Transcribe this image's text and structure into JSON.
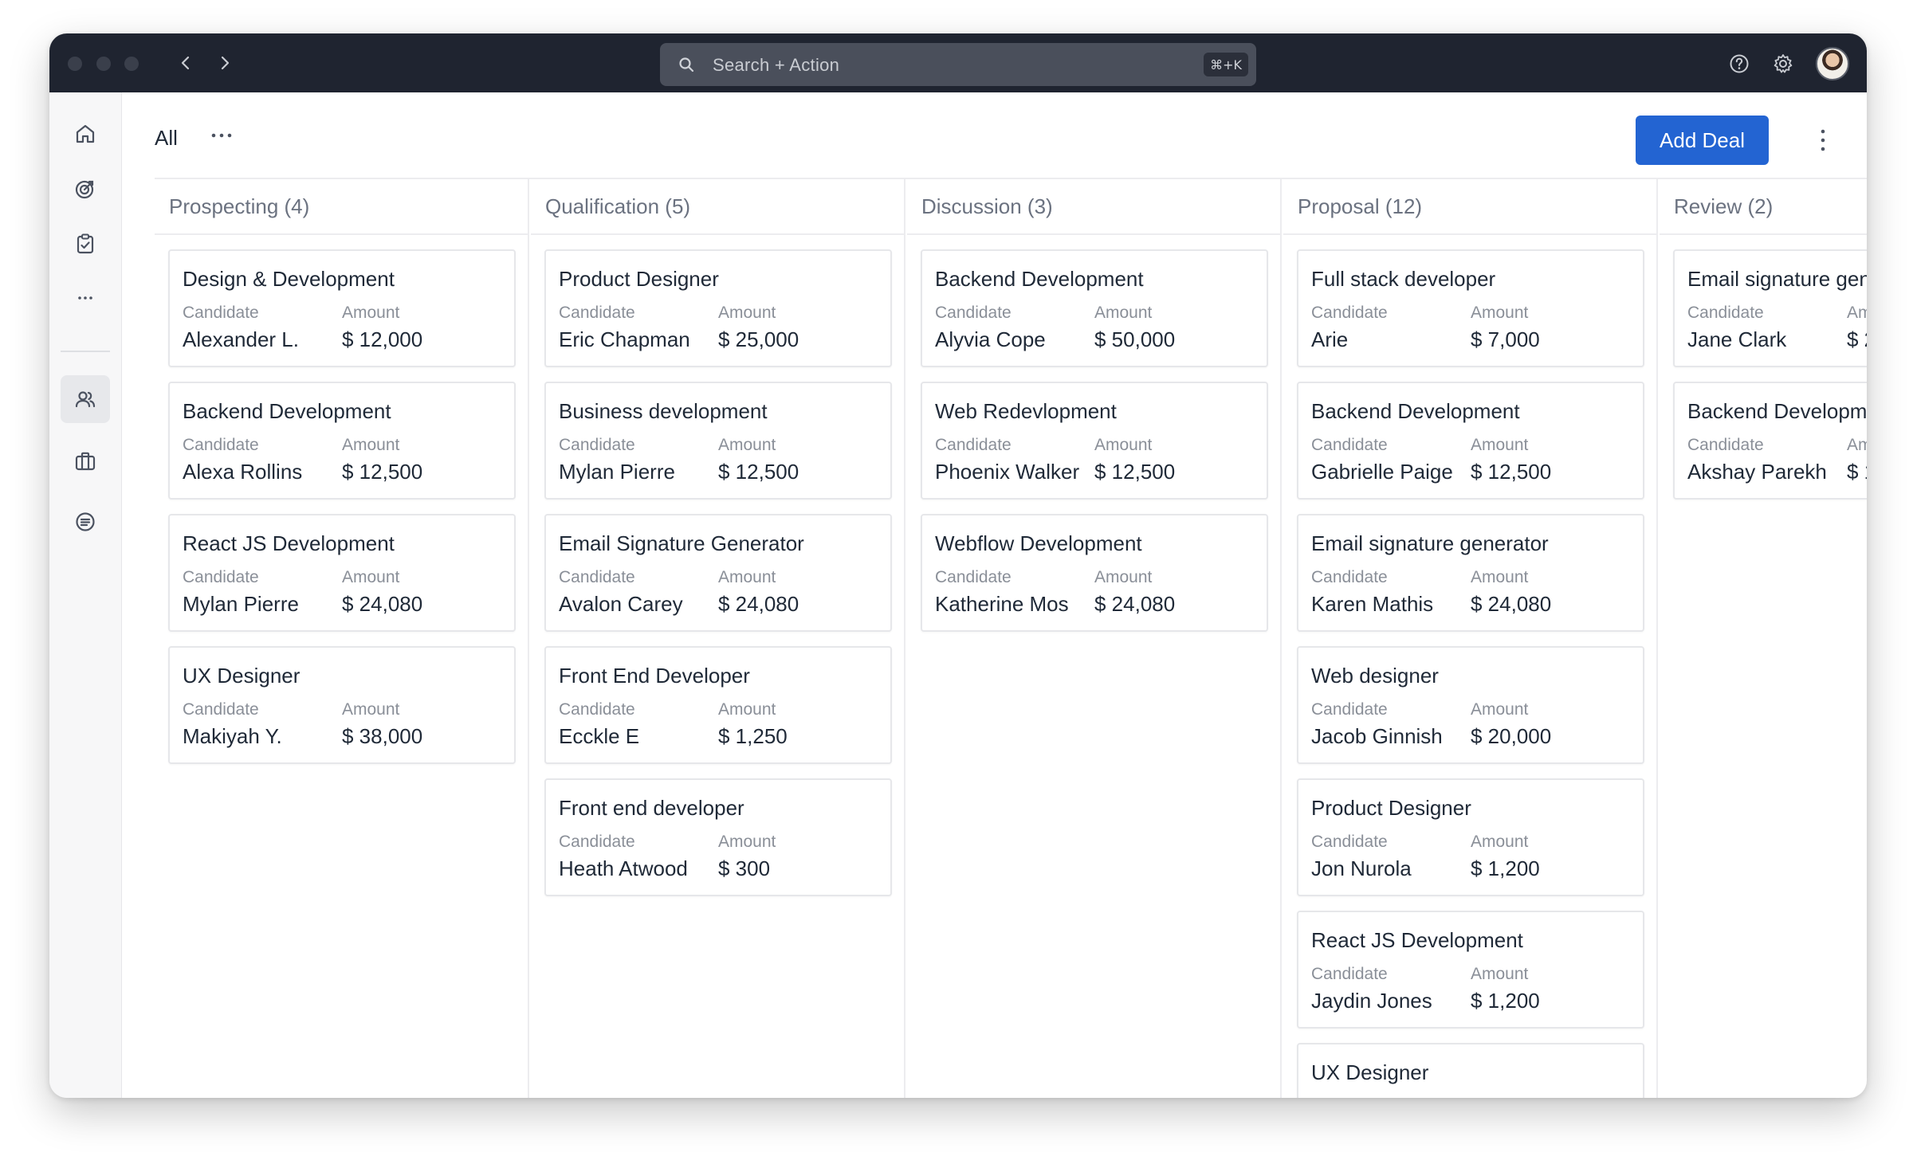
{
  "search": {
    "placeholder": "Search + Action",
    "shortcut": "⌘+K"
  },
  "header": {
    "view_label": "All",
    "add_deal_label": "Add Deal"
  },
  "field_labels": {
    "candidate": "Candidate",
    "amount": "Amount"
  },
  "colors": {
    "accent": "#2364d2",
    "titlebar": "#1f2430"
  },
  "sidebar": {
    "items": [
      {
        "icon": "home-icon"
      },
      {
        "icon": "target-icon"
      },
      {
        "icon": "clipboard-icon"
      },
      {
        "icon": "more-icon"
      },
      {
        "icon": "users-icon",
        "active": true
      },
      {
        "icon": "briefcase-icon"
      },
      {
        "icon": "chat-icon"
      }
    ]
  },
  "columns": [
    {
      "title": "Prospecting (4)",
      "cards": [
        {
          "title": "Design & Development",
          "candidate": "Alexander L.",
          "amount": "$ 12,000"
        },
        {
          "title": "Backend Development",
          "candidate": "Alexa Rollins",
          "amount": "$ 12,500"
        },
        {
          "title": "React JS Development",
          "candidate": "Mylan Pierre",
          "amount": "$ 24,080"
        },
        {
          "title": "UX Designer",
          "candidate": "Makiyah Y.",
          "amount": "$ 38,000"
        }
      ]
    },
    {
      "title": "Qualification (5)",
      "cards": [
        {
          "title": "Product Designer",
          "candidate": "Eric Chapman",
          "amount": "$ 25,000"
        },
        {
          "title": "Business development",
          "candidate": "Mylan Pierre",
          "amount": "$ 12,500"
        },
        {
          "title": "Email Signature Generator",
          "candidate": "Avalon Carey",
          "amount": "$ 24,080"
        },
        {
          "title": "Front End Developer",
          "candidate": "Ecckle E",
          "amount": "$ 1,250"
        },
        {
          "title": "Front end developer",
          "candidate": "Heath Atwood",
          "amount": "$ 300"
        }
      ]
    },
    {
      "title": "Discussion (3)",
      "cards": [
        {
          "title": "Backend Development",
          "candidate": "Alyvia Cope",
          "amount": "$ 50,000"
        },
        {
          "title": "Web Redevlopment",
          "candidate": "Phoenix Walker",
          "amount": "$ 12,500"
        },
        {
          "title": "Webflow Development",
          "candidate": "Katherine Mos",
          "amount": "$ 24,080"
        }
      ]
    },
    {
      "title": "Proposal (12)",
      "cards": [
        {
          "title": "Full stack developer",
          "candidate": "Arie",
          "amount": "$ 7,000"
        },
        {
          "title": "Backend Development",
          "candidate": "Gabrielle Paige",
          "amount": "$ 12,500"
        },
        {
          "title": "Email signature generator",
          "candidate": "Karen Mathis",
          "amount": "$ 24,080"
        },
        {
          "title": "Web designer",
          "candidate": "Jacob Ginnish",
          "amount": "$ 20,000"
        },
        {
          "title": "Product Designer",
          "candidate": "Jon Nurola",
          "amount": "$ 1,200"
        },
        {
          "title": "React JS Development",
          "candidate": "Jaydin Jones",
          "amount": "$ 1,200"
        },
        {
          "title": "UX Designer",
          "candidate": "",
          "amount": ""
        }
      ]
    },
    {
      "title": "Review (2)",
      "cards": [
        {
          "title": "Email signature gen",
          "candidate": "Jane Clark",
          "amount": "$ 2"
        },
        {
          "title": "Backend Developm",
          "candidate": "Akshay Parekh",
          "amount": "$ 1"
        }
      ]
    }
  ]
}
